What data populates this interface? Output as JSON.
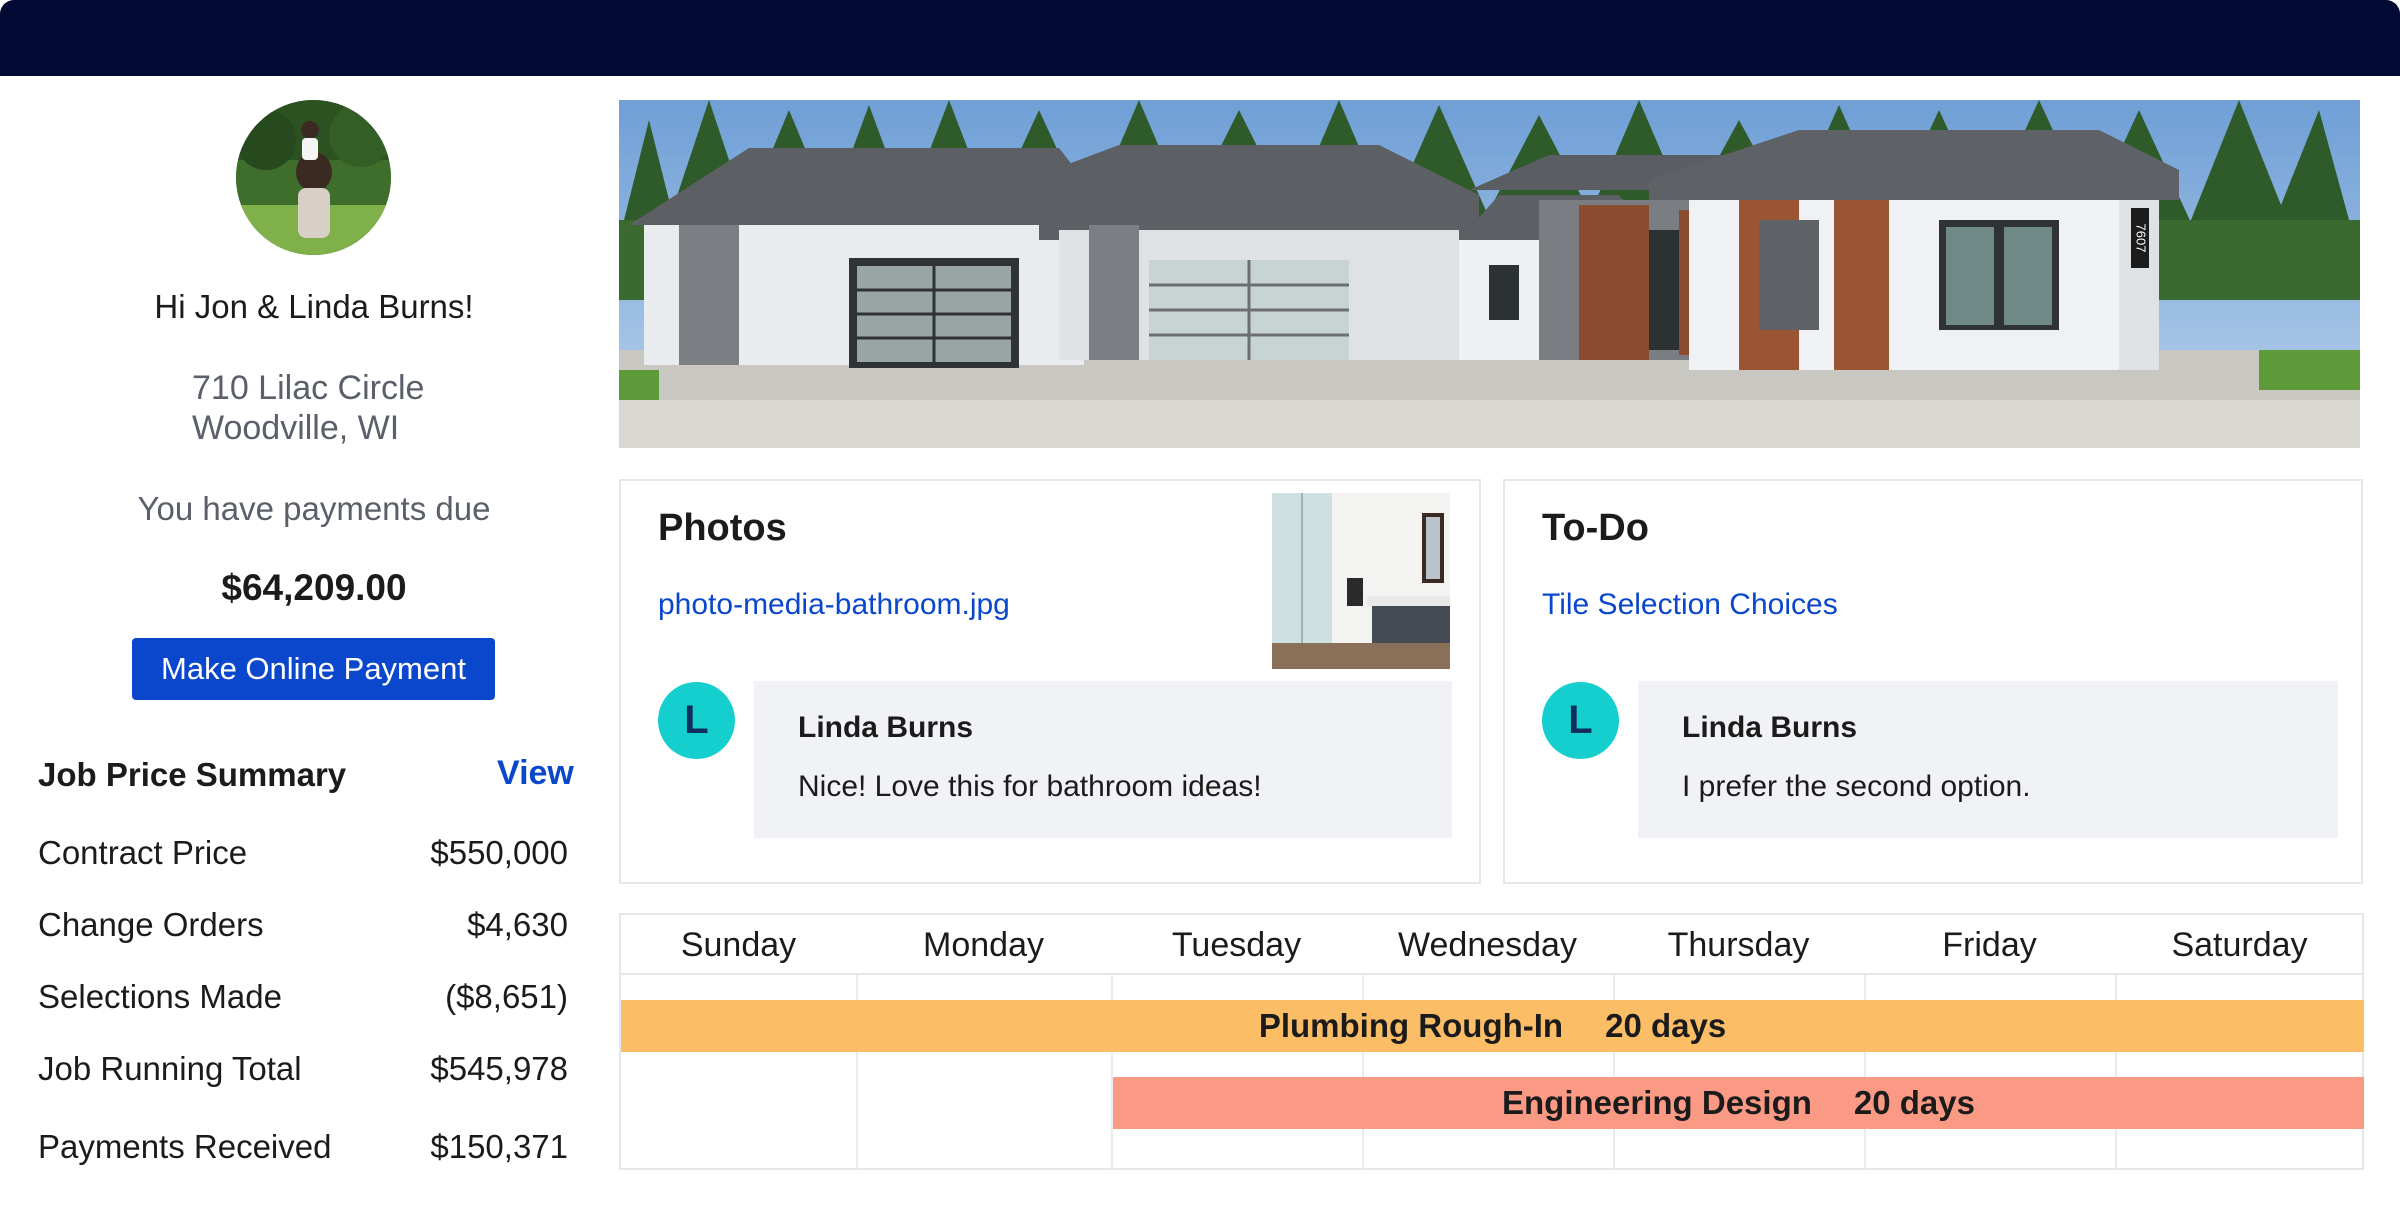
{
  "customer": {
    "greeting": "Hi Jon & Linda Burns!",
    "address_line1": "710 Lilac Circle",
    "address_line2": "Woodville, WI",
    "payments_due_text": "You have payments due",
    "amount_due": "$64,209.00",
    "pay_button_label": "Make Online Payment"
  },
  "summary": {
    "title": "Job Price Summary",
    "view_label": "View",
    "rows": [
      {
        "label": "Contract Price",
        "value": "$550,000"
      },
      {
        "label": "Change Orders",
        "value": "$4,630"
      },
      {
        "label": "Selections Made",
        "value": "($8,651)"
      },
      {
        "label": "Job Running Total",
        "value": "$545,978"
      },
      {
        "label": "Payments Received",
        "value": "$150,371"
      }
    ]
  },
  "hero": {
    "house_number": "7607"
  },
  "photos_card": {
    "title": "Photos",
    "link": "photo-media-bathroom.jpg",
    "comment": {
      "avatar_letter": "L",
      "author": "Linda Burns",
      "text": "Nice! Love this for bathroom ideas!"
    }
  },
  "todo_card": {
    "title": "To-Do",
    "link": "Tile Selection Choices",
    "comment": {
      "avatar_letter": "L",
      "author": "Linda Burns",
      "text": "I prefer the second option."
    }
  },
  "calendar": {
    "days": [
      "Sunday",
      "Monday",
      "Tuesday",
      "Wednesday",
      "Thursday",
      "Friday",
      "Saturday"
    ],
    "events": [
      {
        "name": "Plumbing Rough-In",
        "duration": "20 days",
        "color": "#fbbe67"
      },
      {
        "name": "Engineering Design",
        "duration": "20 days",
        "color": "#fb9a84"
      }
    ]
  },
  "colors": {
    "topbar": "#020a33",
    "accent_blue": "#0a47cc",
    "avatar_teal": "#15cfcf"
  }
}
